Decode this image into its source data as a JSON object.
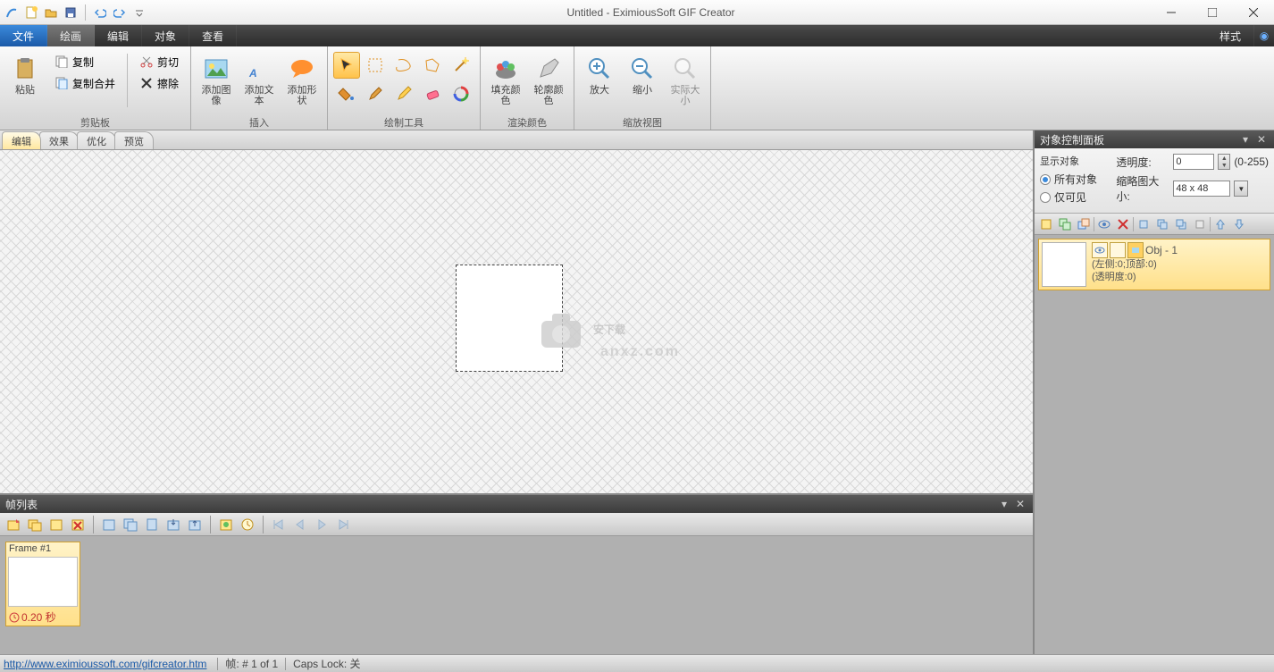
{
  "title": "Untitled - EximiousSoft GIF Creator",
  "menu": {
    "file": "文件",
    "draw": "绘画",
    "edit": "编辑",
    "object": "对象",
    "view": "查看",
    "style": "样式"
  },
  "ribbon": {
    "clipboard": {
      "label": "剪贴板",
      "paste": "粘贴",
      "copy": "复制",
      "copymerge": "复制合并",
      "cut": "剪切",
      "delete": "擦除"
    },
    "insert": {
      "label": "插入",
      "image": "添加图像",
      "text": "添加文本",
      "shape": "添加形状"
    },
    "tools": {
      "label": "绘制工具"
    },
    "render": {
      "label": "渲染颜色",
      "fill": "填充颜色",
      "outline": "轮廓颜色"
    },
    "zoom": {
      "label": "缩放视图",
      "in": "放大",
      "out": "缩小",
      "actual": "实际大小"
    }
  },
  "tabs": {
    "edit": "编辑",
    "effect": "效果",
    "optimize": "优化",
    "preview": "预览"
  },
  "framepanel": {
    "title": "帧列表",
    "frame": {
      "name": "Frame #1",
      "duration": "0.20 秒"
    }
  },
  "rightpanel": {
    "title": "对象控制面板",
    "showobj": "显示对象",
    "allobj": "所有对象",
    "visonly": "仅可见",
    "opacity": "透明度:",
    "opval": "0",
    "oprange": "(0-255)",
    "thumbsize": "缩略图大小:",
    "thumbval": "48 x 48",
    "obj": {
      "name": "Obj - 1",
      "pos": "(左侧:0;顶部:0)",
      "op": "(透明度:0)"
    }
  },
  "status": {
    "link": "http://www.eximioussoft.com/gifcreator.htm",
    "frame": "帧: # 1 of 1",
    "caps": "Caps Lock: 关"
  }
}
